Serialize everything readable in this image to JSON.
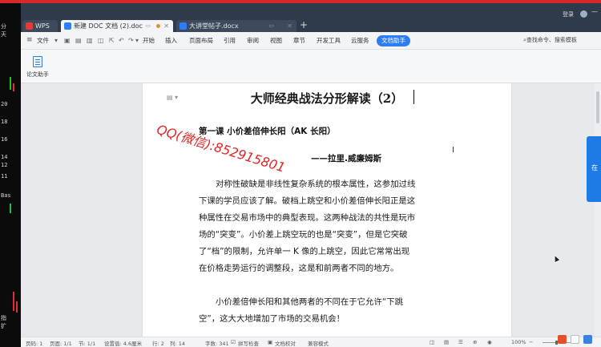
{
  "stock": {
    "labels": [
      "分",
      "天",
      "20",
      "18",
      "16",
      "14",
      "12",
      "11",
      "Bas",
      "指",
      "扩"
    ]
  },
  "tabs": {
    "wps": "WPS",
    "active": "新建 DOC 文档 (2).doc",
    "second": "大讲堂帖子.docx",
    "new_tab": "+"
  },
  "window": {
    "login": "登录"
  },
  "menu": {
    "file": "文件",
    "items": [
      "开始",
      "插入",
      "页面布局",
      "引用",
      "审阅",
      "视图",
      "章节",
      "开发工具",
      "云服务"
    ],
    "assistant": "文档助手",
    "search": "查找命令、搜索模板"
  },
  "ribbon": {
    "paper_assist": "论文助手"
  },
  "document": {
    "title": "大师经典战法分形解读（2）",
    "lesson": "第一课  小价差倍伸长阳（AK 长阳）",
    "author": "——拉里.威廉姆斯",
    "para1": [
      "对称性破缺是非线性复杂系统的根本属性，这参加过线",
      "下课的学员应该了解。破档上跳空和小价差倍伸长阳正是这",
      "种属性在交易市场中的典型表现。这两种战法的共性是玩市",
      "场的“突变”。小价差上跳空玩的也是“突变”，但是它突破",
      "了“档”的限制，允许单一 K 像的上跳空，因此它常常出现",
      "在价格走势运行的调整段，这是和前两者不同的地方。"
    ],
    "para2": [
      "小价差倍伸长阳和其他两者的不同在于它允许“下跳",
      "空”，这大大地增加了市场的交易机会！"
    ]
  },
  "watermark": {
    "line1": "QQ(微信):852915801"
  },
  "right_panel": {
    "label": "在"
  },
  "status": {
    "page": "页码: 1",
    "pages": "页面: 1/1",
    "section": "节: 1/1",
    "position": "设置值: 4.6厘米",
    "row": "行: 2",
    "col": "列: 14",
    "words": "字数: 341",
    "spell": "拼写检查",
    "proof": "文档校对",
    "compat": "兼容模式",
    "zoom": "100%"
  },
  "colors": {
    "accent": "#2f7df6",
    "titlebar": "#2f3a4a",
    "watermark": "#e22525"
  }
}
